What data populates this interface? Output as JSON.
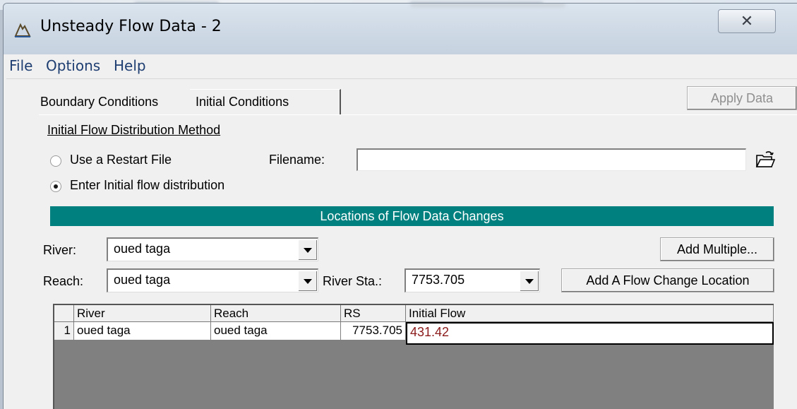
{
  "window": {
    "title": "Unsteady Flow Data - 2",
    "close_glyph": "✕"
  },
  "menu": {
    "items": [
      "File",
      "Options",
      "Help"
    ]
  },
  "tabs": {
    "boundary": "Boundary Conditions",
    "initial": "Initial Conditions",
    "active": "Initial Conditions"
  },
  "apply_button": "Apply Data",
  "initial_flow": {
    "section_label": "Initial Flow Distribution Method",
    "restart_option": "Use a Restart File",
    "restart_selected": false,
    "filename_label": "Filename:",
    "filename_value": "",
    "enter_option": "Enter Initial flow distribution",
    "enter_selected": true
  },
  "locations": {
    "header": "Locations of Flow Data Changes",
    "river_label": "River:",
    "river_value": "oued taga",
    "reach_label": "Reach:",
    "reach_value": "oued taga",
    "station_label": "River Sta.:",
    "station_value": "7753.705",
    "add_multiple": "Add Multiple...",
    "add_location": "Add A Flow Change Location"
  },
  "table": {
    "columns": [
      "River",
      "Reach",
      "RS",
      "Initial Flow"
    ],
    "rows": [
      {
        "num": "1",
        "river": "oued taga",
        "reach": "oued taga",
        "rs": "7753.705",
        "flow": "431.42"
      }
    ]
  },
  "colors": {
    "header_bar": "#00807f",
    "menu_text": "#1e3e72",
    "edit_text": "#8b1a1a"
  }
}
